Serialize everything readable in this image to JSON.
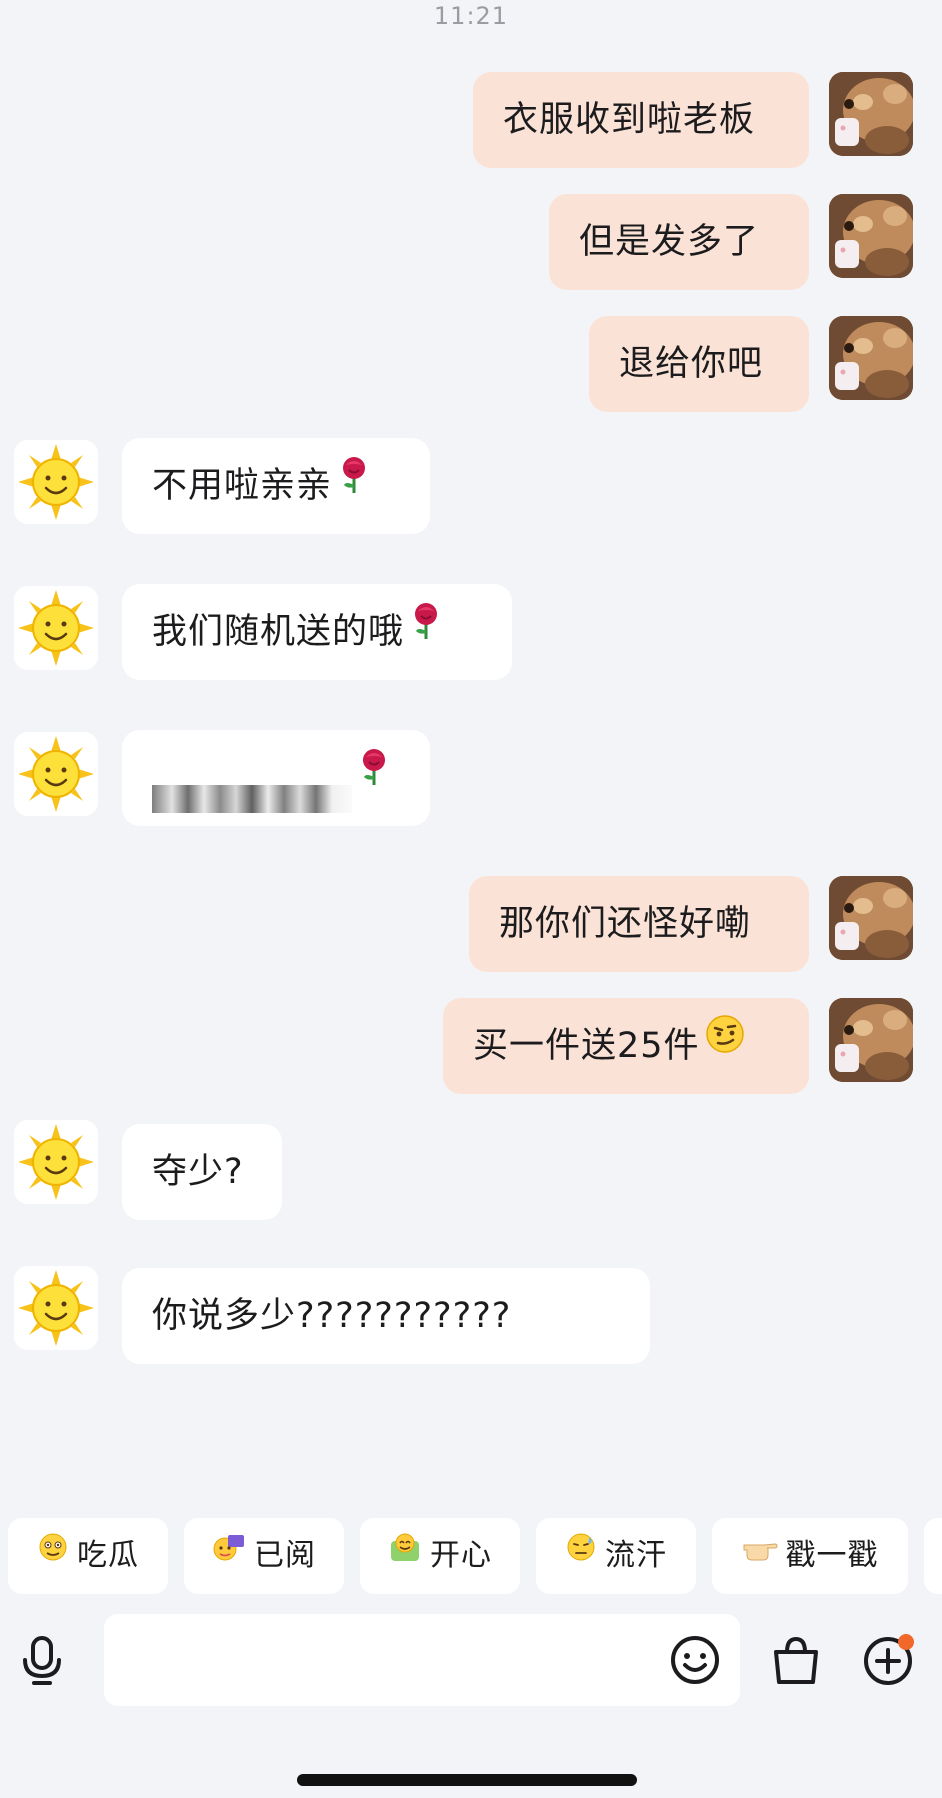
{
  "status": {
    "time": "11:21"
  },
  "messages": [
    {
      "side": "out",
      "text": "衣服收到啦老板"
    },
    {
      "side": "out",
      "text": "但是发多了"
    },
    {
      "side": "out",
      "text": "退给你吧"
    },
    {
      "side": "in",
      "text": "不用啦亲亲",
      "emoji": "rose-emoji"
    },
    {
      "side": "in",
      "text": "我们随机送的哦",
      "emoji": "rose-emoji"
    },
    {
      "side": "in",
      "text": "",
      "redacted": true,
      "emoji": "rose-emoji"
    },
    {
      "side": "out",
      "text": "那你们还怪好嘞"
    },
    {
      "side": "out",
      "text": "买一件送25件",
      "emoji": "smirk-emoji"
    },
    {
      "side": "in",
      "text": "夺少?"
    },
    {
      "side": "in",
      "text": "你说多少???????????"
    }
  ],
  "quick_replies": [
    {
      "label": "吃瓜",
      "icon": "melon-face-icon"
    },
    {
      "label": "已阅",
      "icon": "read-sticker-icon"
    },
    {
      "label": "开心",
      "icon": "happy-sticker-icon"
    },
    {
      "label": "流汗",
      "icon": "sweat-face-icon"
    },
    {
      "label": "戳一戳",
      "icon": "poke-hand-icon"
    }
  ],
  "input": {
    "placeholder": ""
  },
  "toolbar": {
    "voice": "microphone-icon",
    "emoji": "smiley-icon",
    "shop": "shopping-bag-icon",
    "more": "plus-circle-icon",
    "notification_dot_color": "#f2672a"
  },
  "colors": {
    "background": "#f3f4f7",
    "outgoing_bubble": "#fbe2d6",
    "incoming_bubble": "#ffffff"
  }
}
